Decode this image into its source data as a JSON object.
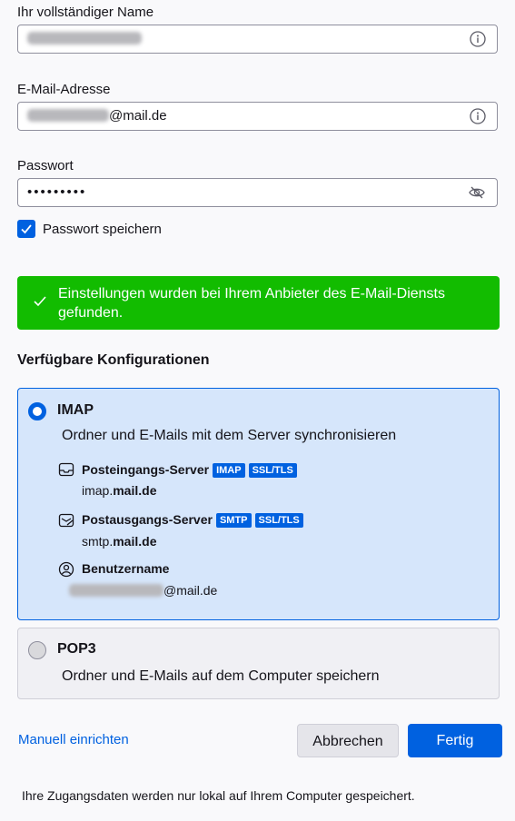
{
  "form": {
    "name_label": "Ihr vollständiger Name",
    "name_value": "",
    "email_label": "E-Mail-Adresse",
    "email_domain": "@mail.de",
    "password_label": "Passwort",
    "password_value": "•••••••••",
    "remember_label": "Passwort speichern",
    "remember_checked": true
  },
  "banner": {
    "text": "Einstellungen wurden bei Ihrem Anbieter des E-Mail-Diensts gefunden.",
    "color": "#12bc00"
  },
  "configs": {
    "heading": "Verfügbare Konfigurationen",
    "imap": {
      "title": "IMAP",
      "description": "Ordner und E-Mails mit dem Server synchronisieren",
      "incoming": {
        "label": "Posteingangs-Server",
        "badges": [
          "IMAP",
          "SSL/TLS"
        ],
        "host_prefix": "imap.",
        "host_domain": "mail.de"
      },
      "outgoing": {
        "label": "Postausgangs-Server",
        "badges": [
          "SMTP",
          "SSL/TLS"
        ],
        "host_prefix": "smtp.",
        "host_domain": "mail.de"
      },
      "username": {
        "label": "Benutzername",
        "domain": "@mail.de"
      },
      "selected": true
    },
    "pop3": {
      "title": "POP3",
      "description": "Ordner und E-Mails auf dem Computer speichern",
      "selected": false
    }
  },
  "actions": {
    "manual_link": "Manuell einrichten",
    "cancel_label": "Abbrechen",
    "done_label": "Fertig"
  },
  "footer": {
    "note": "Ihre Zugangsdaten werden nur lokal auf Ihrem Computer gespeichert."
  },
  "colors": {
    "accent": "#0061e0",
    "success": "#12bc00"
  }
}
